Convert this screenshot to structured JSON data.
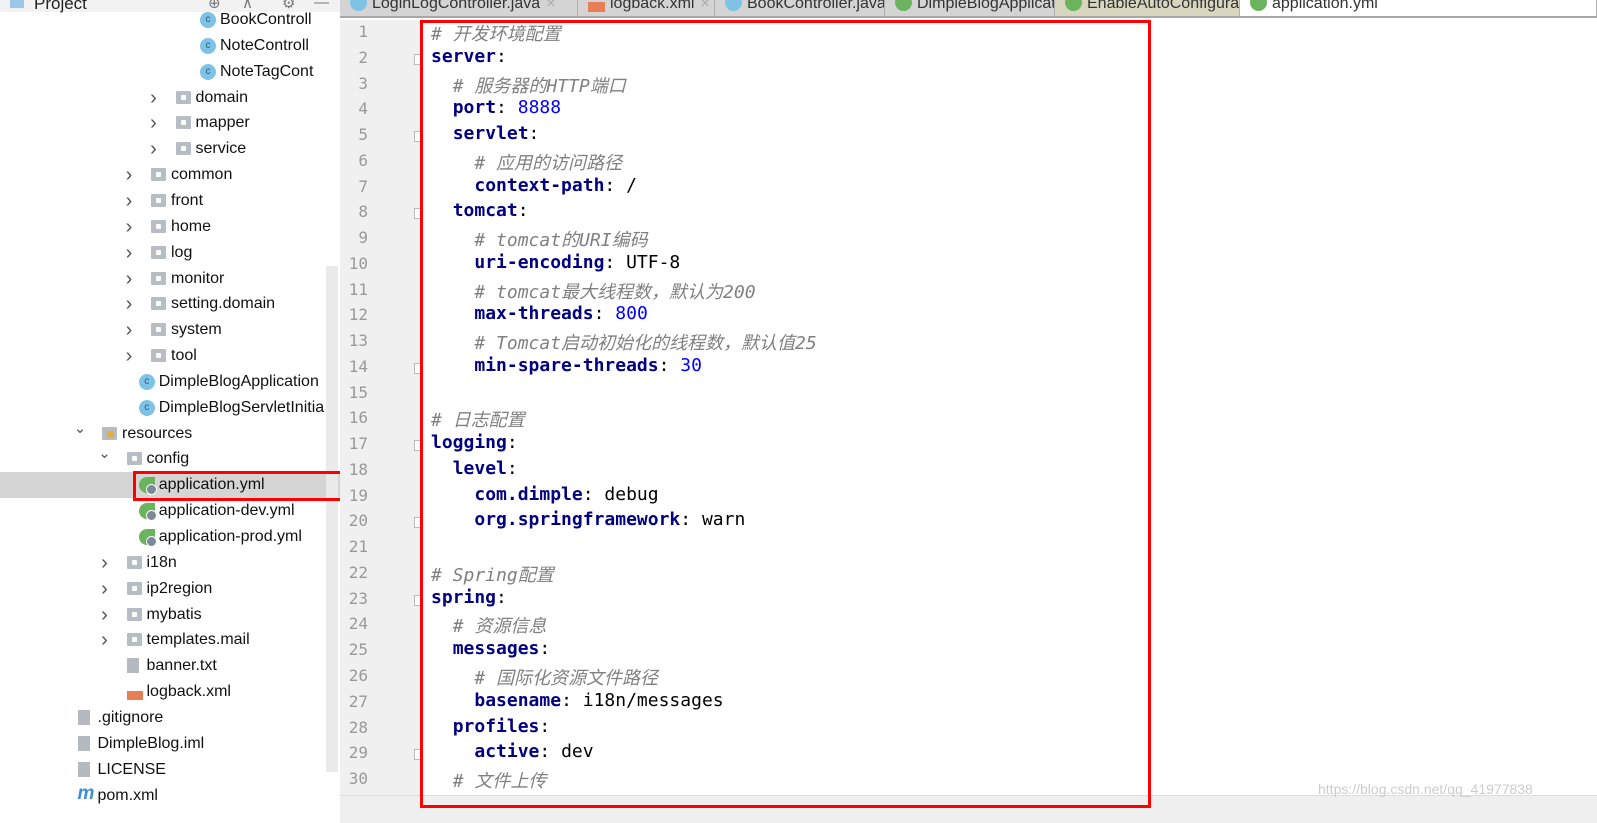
{
  "project_panel": {
    "title": "Project",
    "icons": [
      "target-icon",
      "collapse-icon",
      "gear-icon",
      "minimize-icon"
    ]
  },
  "tree": [
    {
      "label": "BookControll",
      "icon": "class",
      "level": 4,
      "arrow": ""
    },
    {
      "label": "NoteControll",
      "icon": "class",
      "level": 4,
      "arrow": ""
    },
    {
      "label": "NoteTagCont",
      "icon": "class",
      "level": 4,
      "arrow": ""
    },
    {
      "label": "domain",
      "icon": "folder",
      "level": 3,
      "arrow": "right"
    },
    {
      "label": "mapper",
      "icon": "folder",
      "level": 3,
      "arrow": "right"
    },
    {
      "label": "service",
      "icon": "folder",
      "level": 3,
      "arrow": "right"
    },
    {
      "label": "common",
      "icon": "folder",
      "level": 2,
      "arrow": "right"
    },
    {
      "label": "front",
      "icon": "folder",
      "level": 2,
      "arrow": "right"
    },
    {
      "label": "home",
      "icon": "folder",
      "level": 2,
      "arrow": "right"
    },
    {
      "label": "log",
      "icon": "folder",
      "level": 2,
      "arrow": "right"
    },
    {
      "label": "monitor",
      "icon": "folder",
      "level": 2,
      "arrow": "right"
    },
    {
      "label": "setting.domain",
      "icon": "folder",
      "level": 2,
      "arrow": "right"
    },
    {
      "label": "system",
      "icon": "folder",
      "level": 2,
      "arrow": "right"
    },
    {
      "label": "tool",
      "icon": "folder",
      "level": 2,
      "arrow": "right"
    },
    {
      "label": "DimpleBlogApplication",
      "icon": "spring-class",
      "level": 1.5,
      "arrow": ""
    },
    {
      "label": "DimpleBlogServletInitia",
      "icon": "class",
      "level": 1.5,
      "arrow": ""
    },
    {
      "label": "resources",
      "icon": "resources",
      "level": 0,
      "arrow": "down"
    },
    {
      "label": "config",
      "icon": "folder",
      "level": 1,
      "arrow": "down"
    },
    {
      "label": "application.yml",
      "icon": "spring",
      "level": 1.5,
      "arrow": "",
      "selected": true
    },
    {
      "label": "application-dev.yml",
      "icon": "spring",
      "level": 1.5,
      "arrow": ""
    },
    {
      "label": "application-prod.yml",
      "icon": "spring",
      "level": 1.5,
      "arrow": ""
    },
    {
      "label": "i18n",
      "icon": "folder",
      "level": 1,
      "arrow": "right"
    },
    {
      "label": "ip2region",
      "icon": "folder",
      "level": 1,
      "arrow": "right"
    },
    {
      "label": "mybatis",
      "icon": "folder",
      "level": 1,
      "arrow": "right"
    },
    {
      "label": "templates.mail",
      "icon": "folder",
      "level": 1,
      "arrow": "right"
    },
    {
      "label": "banner.txt",
      "icon": "file",
      "level": 1,
      "arrow": ""
    },
    {
      "label": "logback.xml",
      "icon": "xml",
      "level": 1,
      "arrow": ""
    },
    {
      "label": ".gitignore",
      "icon": "file",
      "level": -1,
      "arrow": ""
    },
    {
      "label": "DimpleBlog.iml",
      "icon": "file",
      "level": -1,
      "arrow": ""
    },
    {
      "label": "LICENSE",
      "icon": "file",
      "level": -1,
      "arrow": ""
    },
    {
      "label": "pom.xml",
      "icon": "maven",
      "level": -1,
      "arrow": ""
    }
  ],
  "tabs": [
    {
      "label": "LoginLogController.java",
      "icon": "class",
      "state": ""
    },
    {
      "label": "logback.xml",
      "icon": "xml",
      "state": ""
    },
    {
      "label": "BookController.java",
      "icon": "class",
      "state": ""
    },
    {
      "label": "DimpleBlogApplication.java",
      "icon": "spring-class",
      "state": ""
    },
    {
      "label": "EnableAutoConfiguration.class",
      "icon": "annotation",
      "state": "enable"
    },
    {
      "label": "application.yml",
      "icon": "spring",
      "state": "active"
    }
  ],
  "code": [
    [
      [
        "c",
        "# 开发环境配置"
      ]
    ],
    [
      [
        "k",
        "server"
      ],
      [
        "p",
        ":"
      ]
    ],
    [
      [
        "p",
        "  "
      ],
      [
        "c",
        "# 服务器的HTTP端口"
      ]
    ],
    [
      [
        "p",
        "  "
      ],
      [
        "k",
        "port"
      ],
      [
        "p",
        ": "
      ],
      [
        "n",
        "8888"
      ]
    ],
    [
      [
        "p",
        "  "
      ],
      [
        "k",
        "servlet"
      ],
      [
        "p",
        ":"
      ]
    ],
    [
      [
        "p",
        "    "
      ],
      [
        "c",
        "# 应用的访问路径"
      ]
    ],
    [
      [
        "p",
        "    "
      ],
      [
        "k",
        "context-path"
      ],
      [
        "p",
        ": /"
      ]
    ],
    [
      [
        "p",
        "  "
      ],
      [
        "k",
        "tomcat"
      ],
      [
        "p",
        ":"
      ]
    ],
    [
      [
        "p",
        "    "
      ],
      [
        "c",
        "# tomcat的URI编码"
      ]
    ],
    [
      [
        "p",
        "    "
      ],
      [
        "k",
        "uri-encoding"
      ],
      [
        "p",
        ": UTF-8"
      ]
    ],
    [
      [
        "p",
        "    "
      ],
      [
        "c",
        "# tomcat最大线程数，默认为200"
      ]
    ],
    [
      [
        "p",
        "    "
      ],
      [
        "k",
        "max-threads"
      ],
      [
        "p",
        ": "
      ],
      [
        "n",
        "800"
      ]
    ],
    [
      [
        "p",
        "    "
      ],
      [
        "c",
        "# Tomcat启动初始化的线程数，默认值25"
      ]
    ],
    [
      [
        "p",
        "    "
      ],
      [
        "k",
        "min-spare-threads"
      ],
      [
        "p",
        ": "
      ],
      [
        "n",
        "30"
      ]
    ],
    [],
    [
      [
        "c",
        "# 日志配置"
      ]
    ],
    [
      [
        "k",
        "logging"
      ],
      [
        "p",
        ":"
      ]
    ],
    [
      [
        "p",
        "  "
      ],
      [
        "k",
        "level"
      ],
      [
        "p",
        ":"
      ]
    ],
    [
      [
        "p",
        "    "
      ],
      [
        "k",
        "com.dimple"
      ],
      [
        "p",
        ": debug"
      ]
    ],
    [
      [
        "p",
        "    "
      ],
      [
        "k",
        "org.springframework"
      ],
      [
        "p",
        ": warn"
      ]
    ],
    [],
    [
      [
        "c",
        "# Spring配置"
      ]
    ],
    [
      [
        "k",
        "spring"
      ],
      [
        "p",
        ":"
      ]
    ],
    [
      [
        "p",
        "  "
      ],
      [
        "c",
        "# 资源信息"
      ]
    ],
    [
      [
        "p",
        "  "
      ],
      [
        "k",
        "messages"
      ],
      [
        "p",
        ":"
      ]
    ],
    [
      [
        "p",
        "    "
      ],
      [
        "c",
        "# 国际化资源文件路径"
      ]
    ],
    [
      [
        "p",
        "    "
      ],
      [
        "k",
        "basename"
      ],
      [
        "p",
        ": i18n/messages"
      ]
    ],
    [
      [
        "p",
        "  "
      ],
      [
        "k",
        "profiles"
      ],
      [
        "p",
        ":"
      ]
    ],
    [
      [
        "p",
        "    "
      ],
      [
        "k",
        "active"
      ],
      [
        "p",
        ": dev"
      ]
    ],
    [
      [
        "p",
        "  "
      ],
      [
        "c",
        "# 文件上传"
      ]
    ]
  ],
  "fold_lines": [
    2,
    5,
    8,
    14,
    17,
    20,
    23,
    29
  ],
  "watermark": "https://blog.csdn.net/qq_41977838",
  "colors": {
    "keyword": "#000080",
    "number": "#0000ff",
    "comment": "#808080",
    "highlight": "#ff0000"
  }
}
